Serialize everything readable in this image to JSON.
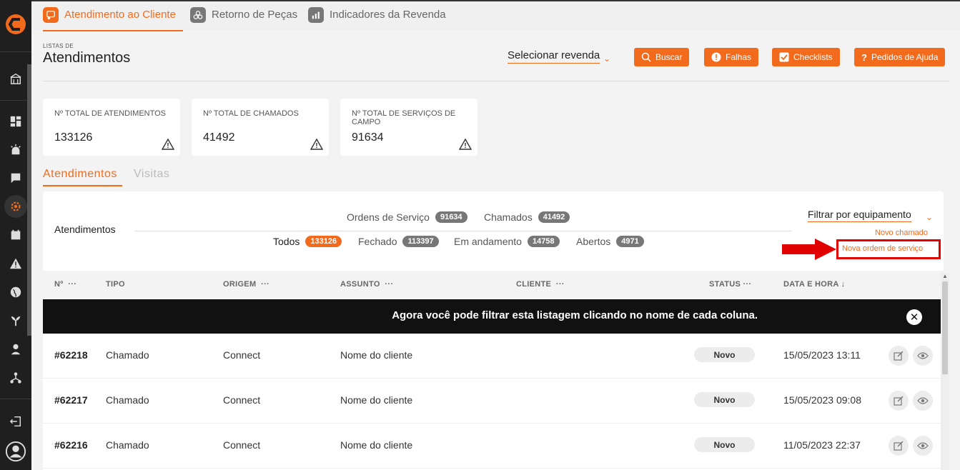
{
  "app": {
    "top_tabs": [
      {
        "label": "Atendimento ao Cliente",
        "icon": "support-icon",
        "active": true
      },
      {
        "label": "Retorno de Peças",
        "icon": "parts-icon",
        "active": false
      },
      {
        "label": "Indicadores da Revenda",
        "icon": "bar-chart-icon",
        "active": false
      }
    ]
  },
  "header": {
    "crumb": "LISTAS DE",
    "title": "Atendimentos",
    "select_revenda": "Selecionar revenda",
    "buttons": [
      {
        "label": "Buscar",
        "icon": "search-icon"
      },
      {
        "label": "Falhas",
        "icon": "alert-icon"
      },
      {
        "label": "Checklists",
        "icon": "checkbox-icon"
      },
      {
        "label": "Pedidos de Ajuda",
        "icon": "help-icon"
      }
    ]
  },
  "stats": [
    {
      "label": "Nº TOTAL DE ATENDIMENTOS",
      "value": "133126"
    },
    {
      "label": "Nº TOTAL DE CHAMADOS",
      "value": "41492"
    },
    {
      "label": "Nº TOTAL DE SERVIÇOS DE CAMPO",
      "value": "91634"
    }
  ],
  "content_tabs": [
    {
      "label": "Atendimentos",
      "active": true
    },
    {
      "label": "Visitas",
      "active": false
    }
  ],
  "panel": {
    "title": "Atendimentos",
    "filters_top": [
      {
        "label": "Ordens de Serviço",
        "count": "91634"
      },
      {
        "label": "Chamados",
        "count": "41492"
      }
    ],
    "filters_bottom": [
      {
        "label": "Todos",
        "count": "133126",
        "active": true
      },
      {
        "label": "Fechado",
        "count": "113397"
      },
      {
        "label": "Em andamento",
        "count": "14758"
      },
      {
        "label": "Abertos",
        "count": "4971"
      }
    ],
    "filter_equipamento": "Filtrar por equipamento",
    "link_novo_chamado": "Novo chamado",
    "link_nova_os": "Nova ordem de serviço"
  },
  "table": {
    "columns": [
      "Nº",
      "TIPO",
      "ORIGEM",
      "ASSUNTO",
      "CLIENTE",
      "STATUS",
      "DATA E HORA"
    ],
    "banner": "Agora você pode filtrar esta listagem clicando no nome de cada coluna.",
    "rows": [
      {
        "num": "#62218",
        "tipo": "Chamado",
        "origem": "Connect",
        "assunto": "Nome do cliente",
        "status": "Novo",
        "data": "15/05/2023 13:11"
      },
      {
        "num": "#62217",
        "tipo": "Chamado",
        "origem": "Connect",
        "assunto": "Nome do cliente",
        "status": "Novo",
        "data": "15/05/2023 09:08"
      },
      {
        "num": "#62216",
        "tipo": "Chamado",
        "origem": "Connect",
        "assunto": "Nome do cliente",
        "status": "Novo",
        "data": "11/05/2023 22:37"
      }
    ]
  },
  "colors": {
    "accent": "#f26b1d",
    "sidebar": "#1f1f1f",
    "highlight": "#e00000"
  }
}
